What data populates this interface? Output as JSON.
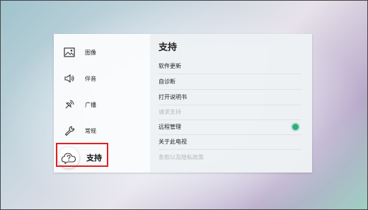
{
  "sidebar": {
    "items": [
      {
        "label": "图像",
        "icon": "picture-icon"
      },
      {
        "label": "伴音",
        "icon": "speaker-icon"
      },
      {
        "label": "广播",
        "icon": "broadcast-icon"
      },
      {
        "label": "常规",
        "icon": "wrench-icon"
      },
      {
        "label": "支持",
        "icon": "support-cloud-icon",
        "active": true
      }
    ]
  },
  "content": {
    "title": "支持",
    "items": [
      {
        "label": "软件更新",
        "enabled": true
      },
      {
        "label": "自诊断",
        "enabled": true
      },
      {
        "label": "打开说明书",
        "enabled": true
      },
      {
        "label": "请求支持",
        "enabled": false
      },
      {
        "label": "远程管理",
        "enabled": true,
        "toggle_on": true
      },
      {
        "label": "关于此电视",
        "enabled": true
      },
      {
        "label": "条款以及隐私政策",
        "enabled": false
      }
    ]
  },
  "colors": {
    "toggle_on": "#2fae7a",
    "highlight_border": "#e02020"
  }
}
